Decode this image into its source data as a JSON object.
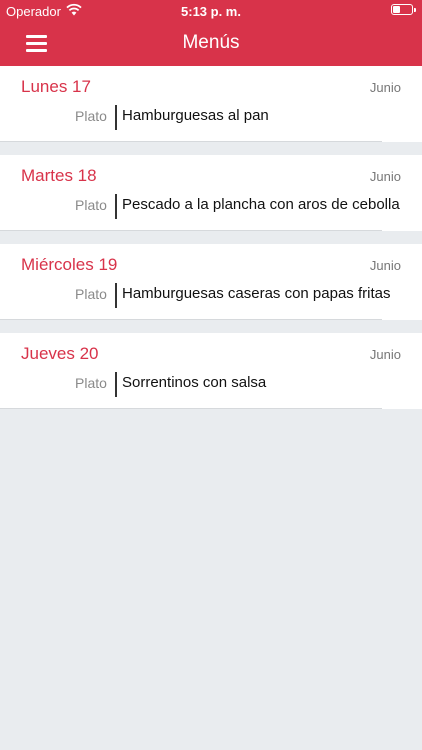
{
  "status_bar": {
    "carrier": "Operador",
    "time": "5:13 p. m.",
    "wifi_icon": "wifi-icon",
    "battery_icon": "battery-icon"
  },
  "header": {
    "title": "Menús",
    "menu_icon": "hamburger-menu-icon",
    "background_color": "#d8334a"
  },
  "menus": [
    {
      "day": "Lunes 17",
      "month": "Junio",
      "label": "Plato",
      "dish": "Hamburguesas al pan"
    },
    {
      "day": "Martes 18",
      "month": "Junio",
      "label": "Plato",
      "dish": "Pescado a la plancha con aros de cebolla"
    },
    {
      "day": "Miércoles 19",
      "month": "Junio",
      "label": "Plato",
      "dish": "Hamburguesas caseras con papas fritas"
    },
    {
      "day": "Jueves 20",
      "month": "Junio",
      "label": "Plato",
      "dish": "Sorrentinos con salsa"
    }
  ]
}
